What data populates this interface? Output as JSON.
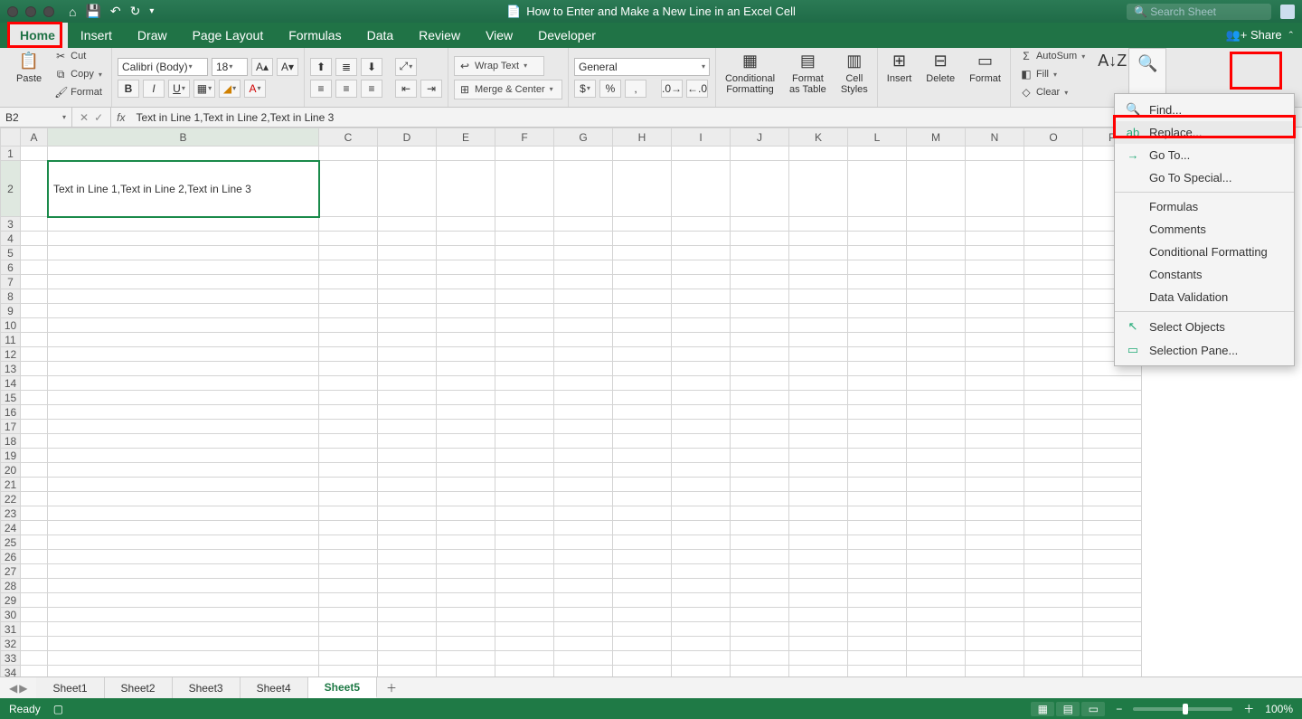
{
  "titlebar": {
    "doc_title": "How to Enter and Make a New Line in an Excel Cell",
    "search_placeholder": "Search Sheet"
  },
  "tabs": {
    "items": [
      "Home",
      "Insert",
      "Draw",
      "Page Layout",
      "Formulas",
      "Data",
      "Review",
      "View",
      "Developer"
    ],
    "active_index": 0,
    "share": "Share"
  },
  "ribbon": {
    "paste": "Paste",
    "cut": "Cut",
    "copy": "Copy",
    "format_painter": "Format",
    "font_name": "Calibri (Body)",
    "font_size": "18",
    "wrap": "Wrap Text",
    "merge": "Merge & Center",
    "number_format": "General",
    "cond_fmt": "Conditional\nFormatting",
    "fmt_table": "Format\nas Table",
    "cell_styles": "Cell\nStyles",
    "insert": "Insert",
    "delete": "Delete",
    "format": "Format",
    "autosum": "AutoSum",
    "fill": "Fill",
    "clear": "Clear"
  },
  "find_menu": {
    "find": "Find...",
    "replace": "Replace...",
    "goto": "Go To...",
    "goto_special": "Go To Special...",
    "formulas": "Formulas",
    "comments": "Comments",
    "cond_fmt": "Conditional Formatting",
    "constants": "Constants",
    "data_val": "Data Validation",
    "select_obj": "Select Objects",
    "sel_pane": "Selection Pane..."
  },
  "formula_bar": {
    "name_box": "B2",
    "content": "Text in Line 1,Text in Line 2,Text in Line 3"
  },
  "grid": {
    "cols": [
      "A",
      "B",
      "C",
      "D",
      "E",
      "F",
      "G",
      "H",
      "I",
      "J",
      "K",
      "L",
      "M",
      "N",
      "O",
      "P"
    ],
    "rows": 34,
    "b2": "Text in Line 1,Text in Line 2,Text in Line 3"
  },
  "sheet_tabs": {
    "items": [
      "Sheet1",
      "Sheet2",
      "Sheet3",
      "Sheet4",
      "Sheet5"
    ],
    "active_index": 4
  },
  "status": {
    "ready": "Ready",
    "zoom": "100%"
  }
}
